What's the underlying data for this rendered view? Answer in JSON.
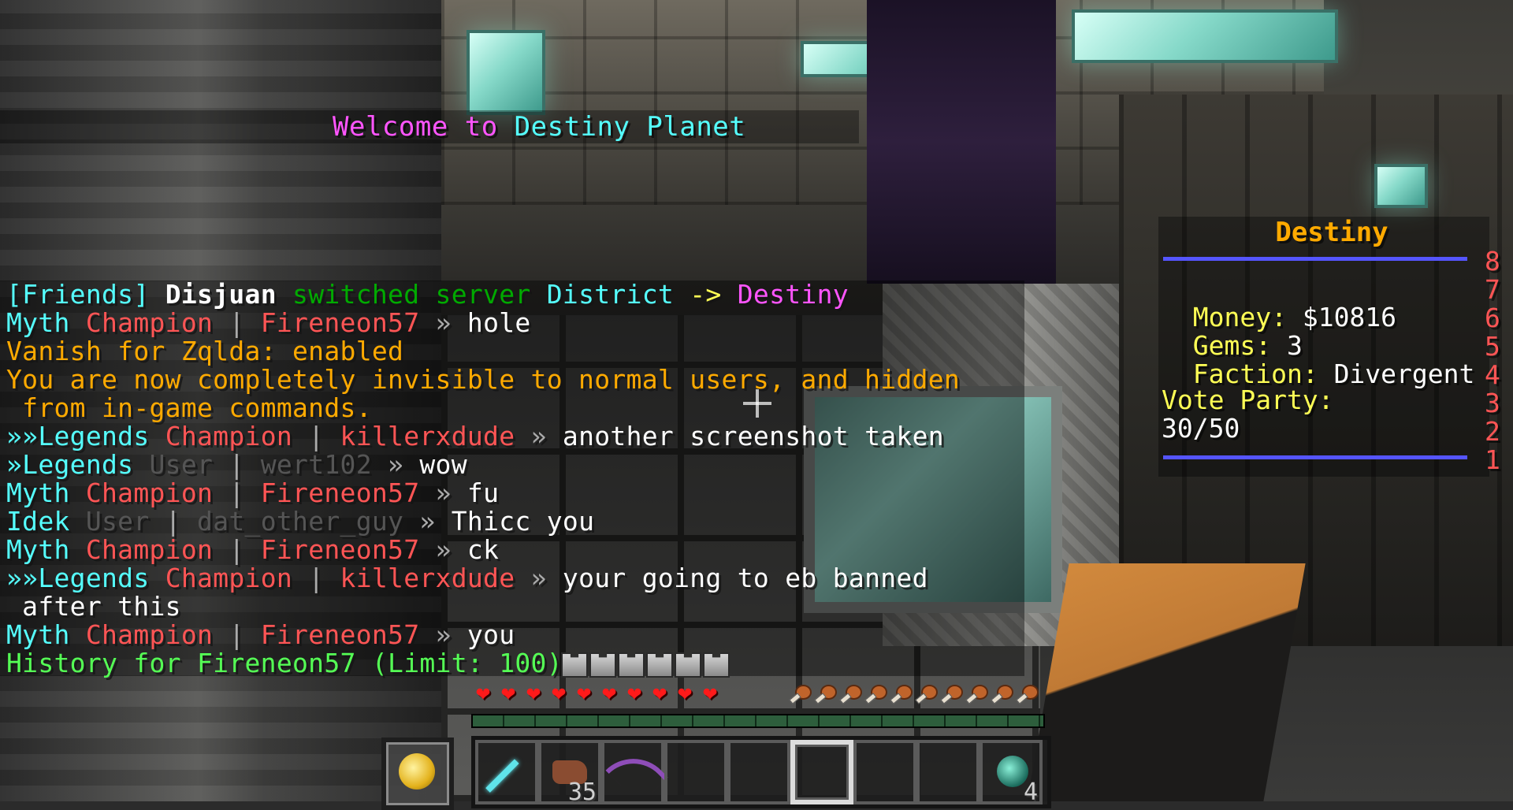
{
  "welcome": {
    "prefix": "Welcome to ",
    "name": "Destiny Planet"
  },
  "chat": [
    {
      "segments": [
        {
          "t": "[Friends] ",
          "c": "c-aqua"
        },
        {
          "t": "Disjuan",
          "c": "c-white bold"
        },
        {
          "t": " switched server ",
          "c": "c-dgreen"
        },
        {
          "t": "District",
          "c": "c-aqua"
        },
        {
          "t": " -> ",
          "c": "c-yellow"
        },
        {
          "t": "Destiny",
          "c": "c-pink"
        }
      ]
    },
    {
      "segments": [
        {
          "t": "Myth ",
          "c": "c-aqua"
        },
        {
          "t": "Champion ",
          "c": "c-red"
        },
        {
          "t": "| ",
          "c": "c-gray"
        },
        {
          "t": "Fireneon57 ",
          "c": "c-red"
        },
        {
          "t": "» ",
          "c": "c-gray"
        },
        {
          "t": "hole",
          "c": "c-white"
        }
      ]
    },
    {
      "segments": [
        {
          "t": "Vanish for Zqlda: enabled",
          "c": "c-gold"
        }
      ]
    },
    {
      "segments": [
        {
          "t": "You are now completely invisible to normal users, and hidden",
          "c": "c-gold"
        }
      ]
    },
    {
      "segments": [
        {
          "t": " from in-game commands.",
          "c": "c-gold"
        }
      ]
    },
    {
      "segments": [
        {
          "t": "»»Legends ",
          "c": "c-aqua"
        },
        {
          "t": "Champion ",
          "c": "c-red"
        },
        {
          "t": "| ",
          "c": "c-gray"
        },
        {
          "t": "killerxdude ",
          "c": "c-red"
        },
        {
          "t": "» ",
          "c": "c-gray"
        },
        {
          "t": "another screenshot taken",
          "c": "c-white"
        }
      ]
    },
    {
      "segments": [
        {
          "t": "»Legends ",
          "c": "c-aqua"
        },
        {
          "t": "User ",
          "c": "c-dgray"
        },
        {
          "t": "| ",
          "c": "c-gray"
        },
        {
          "t": "wert102 ",
          "c": "c-dgray"
        },
        {
          "t": "» ",
          "c": "c-gray"
        },
        {
          "t": "wow",
          "c": "c-white"
        }
      ]
    },
    {
      "segments": [
        {
          "t": "Myth ",
          "c": "c-aqua"
        },
        {
          "t": "Champion ",
          "c": "c-red"
        },
        {
          "t": "| ",
          "c": "c-gray"
        },
        {
          "t": "Fireneon57 ",
          "c": "c-red"
        },
        {
          "t": "» ",
          "c": "c-gray"
        },
        {
          "t": "fu",
          "c": "c-white"
        }
      ]
    },
    {
      "segments": [
        {
          "t": "Idek ",
          "c": "c-aqua"
        },
        {
          "t": "User ",
          "c": "c-dgray"
        },
        {
          "t": "| ",
          "c": "c-gray"
        },
        {
          "t": "dat_other_guy ",
          "c": "c-dgray"
        },
        {
          "t": "» ",
          "c": "c-gray"
        },
        {
          "t": "Thicc you",
          "c": "c-white"
        }
      ]
    },
    {
      "segments": [
        {
          "t": "Myth ",
          "c": "c-aqua"
        },
        {
          "t": "Champion ",
          "c": "c-red"
        },
        {
          "t": "| ",
          "c": "c-gray"
        },
        {
          "t": "Fireneon57 ",
          "c": "c-red"
        },
        {
          "t": "» ",
          "c": "c-gray"
        },
        {
          "t": "ck",
          "c": "c-white"
        }
      ]
    },
    {
      "segments": [
        {
          "t": "»»Legends ",
          "c": "c-aqua"
        },
        {
          "t": "Champion ",
          "c": "c-red"
        },
        {
          "t": "| ",
          "c": "c-gray"
        },
        {
          "t": "killerxdude ",
          "c": "c-red"
        },
        {
          "t": "» ",
          "c": "c-gray"
        },
        {
          "t": "your going to eb banned",
          "c": "c-white"
        }
      ]
    },
    {
      "segments": [
        {
          "t": " after this",
          "c": "c-white"
        }
      ]
    },
    {
      "segments": [
        {
          "t": "Myth ",
          "c": "c-aqua"
        },
        {
          "t": "Champion ",
          "c": "c-red"
        },
        {
          "t": "| ",
          "c": "c-gray"
        },
        {
          "t": "Fireneon57 ",
          "c": "c-red"
        },
        {
          "t": "» ",
          "c": "c-gray"
        },
        {
          "t": "you",
          "c": "c-white"
        }
      ]
    },
    {
      "segments": [
        {
          "t": "History for Fireneon57 (Limit: 100):",
          "c": "c-green"
        }
      ]
    }
  ],
  "sidebar": {
    "title": "Destiny",
    "money_label": "Money: ",
    "money_value": "$10816",
    "gems_label": "Gems: ",
    "gems_value": "3",
    "faction_label": "Faction: ",
    "faction_value": "Divergent",
    "vote_label": "Vote Party:",
    "vote_value": "30/50",
    "line_numbers": [
      "8",
      "7",
      "6",
      "5",
      "4",
      "3",
      "2",
      "1"
    ]
  },
  "hud": {
    "armor_count": 6,
    "hearts_count": 10,
    "food_count": 10,
    "xp_fraction": 1.0,
    "selected_slot": 5,
    "hotbar": [
      {
        "item": "diamond-sword-icon",
        "count": ""
      },
      {
        "item": "leather-icon",
        "count": "35"
      },
      {
        "item": "bow-icon",
        "count": ""
      },
      {
        "item": "",
        "count": ""
      },
      {
        "item": "",
        "count": ""
      },
      {
        "item": "",
        "count": ""
      },
      {
        "item": "",
        "count": ""
      },
      {
        "item": "",
        "count": ""
      },
      {
        "item": "ender-pearl-icon",
        "count": "4"
      }
    ],
    "offhand_item": "golden-apple-icon"
  },
  "colors": {
    "welcome_prefix": "#ff55ff",
    "welcome_name": "#55ffff",
    "sidebar_title": "#ffaa00",
    "sidebar_labels": "#ffff55",
    "sidebar_values": "#ffffff",
    "sidebar_separator": "#5555ff",
    "sidebar_numbers": "#ff5555"
  }
}
